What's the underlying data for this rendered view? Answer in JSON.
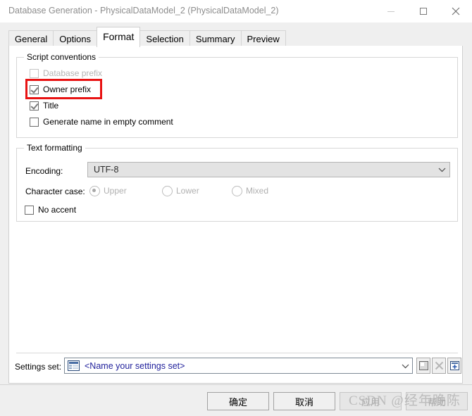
{
  "window": {
    "title": "Database Generation - PhysicalDataModel_2 (PhysicalDataModel_2)",
    "minimize_icon": "minimize-icon",
    "maximize_icon": "maximize-icon",
    "close_icon": "close-icon"
  },
  "tabs": [
    {
      "label": "General",
      "active": false
    },
    {
      "label": "Options",
      "active": false
    },
    {
      "label": "Format",
      "active": true
    },
    {
      "label": "Selection",
      "active": false
    },
    {
      "label": "Summary",
      "active": false
    },
    {
      "label": "Preview",
      "active": false
    }
  ],
  "script_conventions": {
    "title": "Script conventions",
    "checkboxes": [
      {
        "label": "Database prefix",
        "checked": false,
        "enabled": false,
        "highlighted": false
      },
      {
        "label": "Owner prefix",
        "checked": true,
        "enabled": true,
        "highlighted": true
      },
      {
        "label": "Title",
        "checked": true,
        "enabled": true,
        "highlighted": false
      },
      {
        "label": "Generate name in empty comment",
        "checked": false,
        "enabled": true,
        "highlighted": false
      }
    ]
  },
  "text_formatting": {
    "title": "Text formatting",
    "encoding_label": "Encoding:",
    "encoding_value": "UTF-8",
    "character_case_label": "Character case:",
    "character_case_options": [
      {
        "label": "Upper",
        "selected": true
      },
      {
        "label": "Lower",
        "selected": false
      },
      {
        "label": "Mixed",
        "selected": false
      }
    ],
    "no_accent": {
      "label": "No accent",
      "checked": false
    }
  },
  "settings_set": {
    "label": "Settings set:",
    "value": "<Name your settings set>",
    "buttons": [
      {
        "name": "save-settings-set-button",
        "enabled": true
      },
      {
        "name": "delete-settings-set-button",
        "enabled": false
      },
      {
        "name": "new-settings-set-button",
        "enabled": true
      }
    ]
  },
  "footer": {
    "ok": "确定",
    "cancel": "取消",
    "apply": "应用",
    "help": "帮助"
  },
  "watermark": "CSDN @经年晚陈",
  "colors": {
    "highlight": "#e81313",
    "dialog_bg": "#efefef",
    "page_bg": "#ffffff",
    "link_text": "#22229c"
  }
}
